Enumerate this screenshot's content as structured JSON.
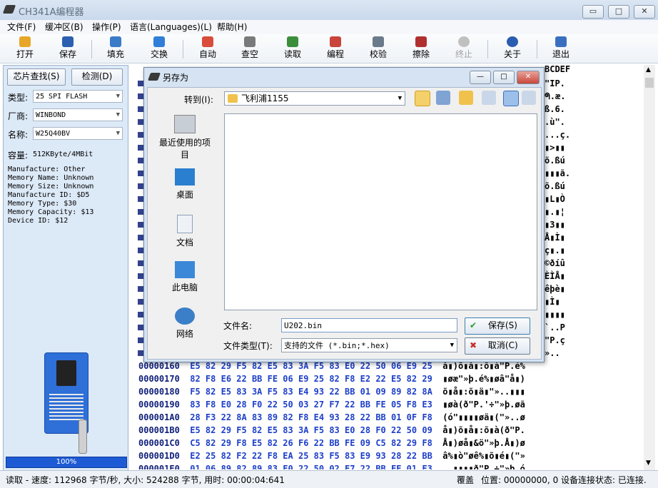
{
  "app": {
    "title": "CH341A编程器"
  },
  "window_controls": {
    "minimize": "▭",
    "maximize": "□",
    "close": "✕"
  },
  "menu": [
    "文件(F)",
    "缓冲区(B)",
    "操作(P)",
    "语言(Languages)(L)",
    "帮助(H)"
  ],
  "toolbar": [
    {
      "label": "打开",
      "icon": "open-icon",
      "color": "#e8a628"
    },
    {
      "label": "保存",
      "icon": "save-icon",
      "color": "#2c5fb0"
    },
    {
      "label": "填充",
      "icon": "fill-icon",
      "color": "#3a7bc8"
    },
    {
      "label": "交换",
      "icon": "swap-icon",
      "color": "#2f7ed8"
    },
    {
      "label": "自动",
      "icon": "auto-icon",
      "color": "#d94b3a"
    },
    {
      "label": "查空",
      "icon": "blank-check-icon",
      "color": "#7a7a7a"
    },
    {
      "label": "读取",
      "icon": "read-icon",
      "color": "#3b8f3b"
    },
    {
      "label": "编程",
      "icon": "program-icon",
      "color": "#c9443a"
    },
    {
      "label": "校验",
      "icon": "verify-icon",
      "color": "#6a7a8a"
    },
    {
      "label": "擦除",
      "icon": "erase-icon",
      "color": "#b03030"
    },
    {
      "label": "终止",
      "icon": "stop-icon",
      "color": "#b0b0b0",
      "disabled": true
    },
    {
      "label": "关于",
      "icon": "info-icon",
      "color": "#2a5db0"
    },
    {
      "label": "退出",
      "icon": "exit-icon",
      "color": "#3a6fc0"
    }
  ],
  "left": {
    "chip_search": "芯片查找(S)",
    "detect": "检测(D)",
    "type_label": "类型:",
    "type_value": "25 SPI FLASH",
    "vendor_label": "厂商:",
    "vendor_value": "WINBOND",
    "name_label": "名称:",
    "name_value": "W25Q40BV",
    "capacity_label": "容量:",
    "capacity_value": "512KByte/4MBit",
    "info": [
      "Manufacture: Other",
      "Memory Name: Unknown",
      "Memory Size: Unknown",
      "Manufacture ID: $D5",
      "Memory Type: $30",
      "Memory Capacity: $13",
      "Device ID: $12"
    ],
    "progress": "100%",
    "progress_value": 1.0
  },
  "hex": {
    "col_header": "BCDEF",
    "right_chars": [
      "\"IP.",
      "ᖗ.æ.",
      "ß.6.",
      ".ù\".",
      "...ç.",
      "▮>▮▮",
      "õ.ßú",
      "▮▮▮ã.",
      "õ.ßú",
      "▮L▮Ò",
      "▮.▮¦",
      "▮3▮▮",
      "Å▮Ì▮",
      "ç▮.▮",
      "©ðíû",
      "ÈÌÅ▮",
      "êþè▮",
      "▮Ì▮",
      "▮▮▮▮",
      "`..P",
      "\"P.ç",
      "».."
    ],
    "rows": [
      {
        "addr": "00000160",
        "bytes": "E5 82 29 F5 82 E5 83 3A F5 83 E0 22 50 06 E9 25",
        "ascii": "å▮)õ▮å▮:õ▮à\"P.é%"
      },
      {
        "addr": "00000170",
        "bytes": "82 F8 E6 22 BB FE 06 E9 25 82 F8 E2 22 E5 82 29",
        "ascii": "▮øæ\"»þ.é%▮øâ\"å▮)"
      },
      {
        "addr": "00000180",
        "bytes": "F5 82 E5 83 3A F5 83 E4 93 22 BB 01 09 89 82 8A",
        "ascii": "õ▮å▮:õ▮ä▮\"»..▮▮▮"
      },
      {
        "addr": "00000190",
        "bytes": "83 F8 E0 28 F0 22 50 03 27 F7 22 BB FE 05 F8 E3",
        "ascii": "▮øà(ð\"P.'÷\"»þ.øã"
      },
      {
        "addr": "000001A0",
        "bytes": "28 F3 22 8A 83 89 82 F8 E4 93 28 22 BB 01 0F F8",
        "ascii": "(ó\"▮▮▮▮øä▮(\"»..ø"
      },
      {
        "addr": "000001B0",
        "bytes": "E5 82 29 F5 82 E5 83 3A F5 83 E0 28 F0 22 50 09",
        "ascii": "å▮)õ▮å▮:õ▮à(ð\"P."
      },
      {
        "addr": "000001C0",
        "bytes": "C5 82 29 F8 E5 82 26 F6 22 BB FE 09 C5 82 29 F8",
        "ascii": "Å▮)øå▮&ö\"»þ.Å▮)ø"
      },
      {
        "addr": "000001D0",
        "bytes": "E2 25 82 F2 22 F8 EA 25 83 F5 83 E9 93 28 22 BB",
        "ascii": "â%▮ò\"øê%▮õ▮é▮(\"»"
      },
      {
        "addr": "000001E0",
        "bytes": "01 06 89 82 89 83 F0 22 50 02 F7 22 BB FE 01 F3",
        "ascii": "..▮▮▮▮ð\"P.÷\"»þ.ó"
      }
    ]
  },
  "status": {
    "left": "读取 - 速度: 112968 字节/秒, 大小: 524288 字节, 用时: 00:00:04:641",
    "mode": "覆盖",
    "position": "位置: 00000000, 0",
    "device": "设备连接状态: 已连接."
  },
  "dialog": {
    "title": "另存为",
    "lookin_label": "转到(I):",
    "folder": "飞利浦1155",
    "nav": [
      {
        "label": "最近使用的项目",
        "icon": "recent-items-icon"
      },
      {
        "label": "桌面",
        "icon": "desktop-icon"
      },
      {
        "label": "文档",
        "icon": "documents-icon"
      },
      {
        "label": "此电脑",
        "icon": "this-pc-icon"
      },
      {
        "label": "网络",
        "icon": "network-icon"
      }
    ],
    "filename_label": "文件名:",
    "filename_value": "U202.bin",
    "filetype_label": "文件类型(T):",
    "filetype_value": "支持的文件 (*.bin;*.hex)",
    "save": "保存(S)",
    "cancel": "取消(C)"
  }
}
